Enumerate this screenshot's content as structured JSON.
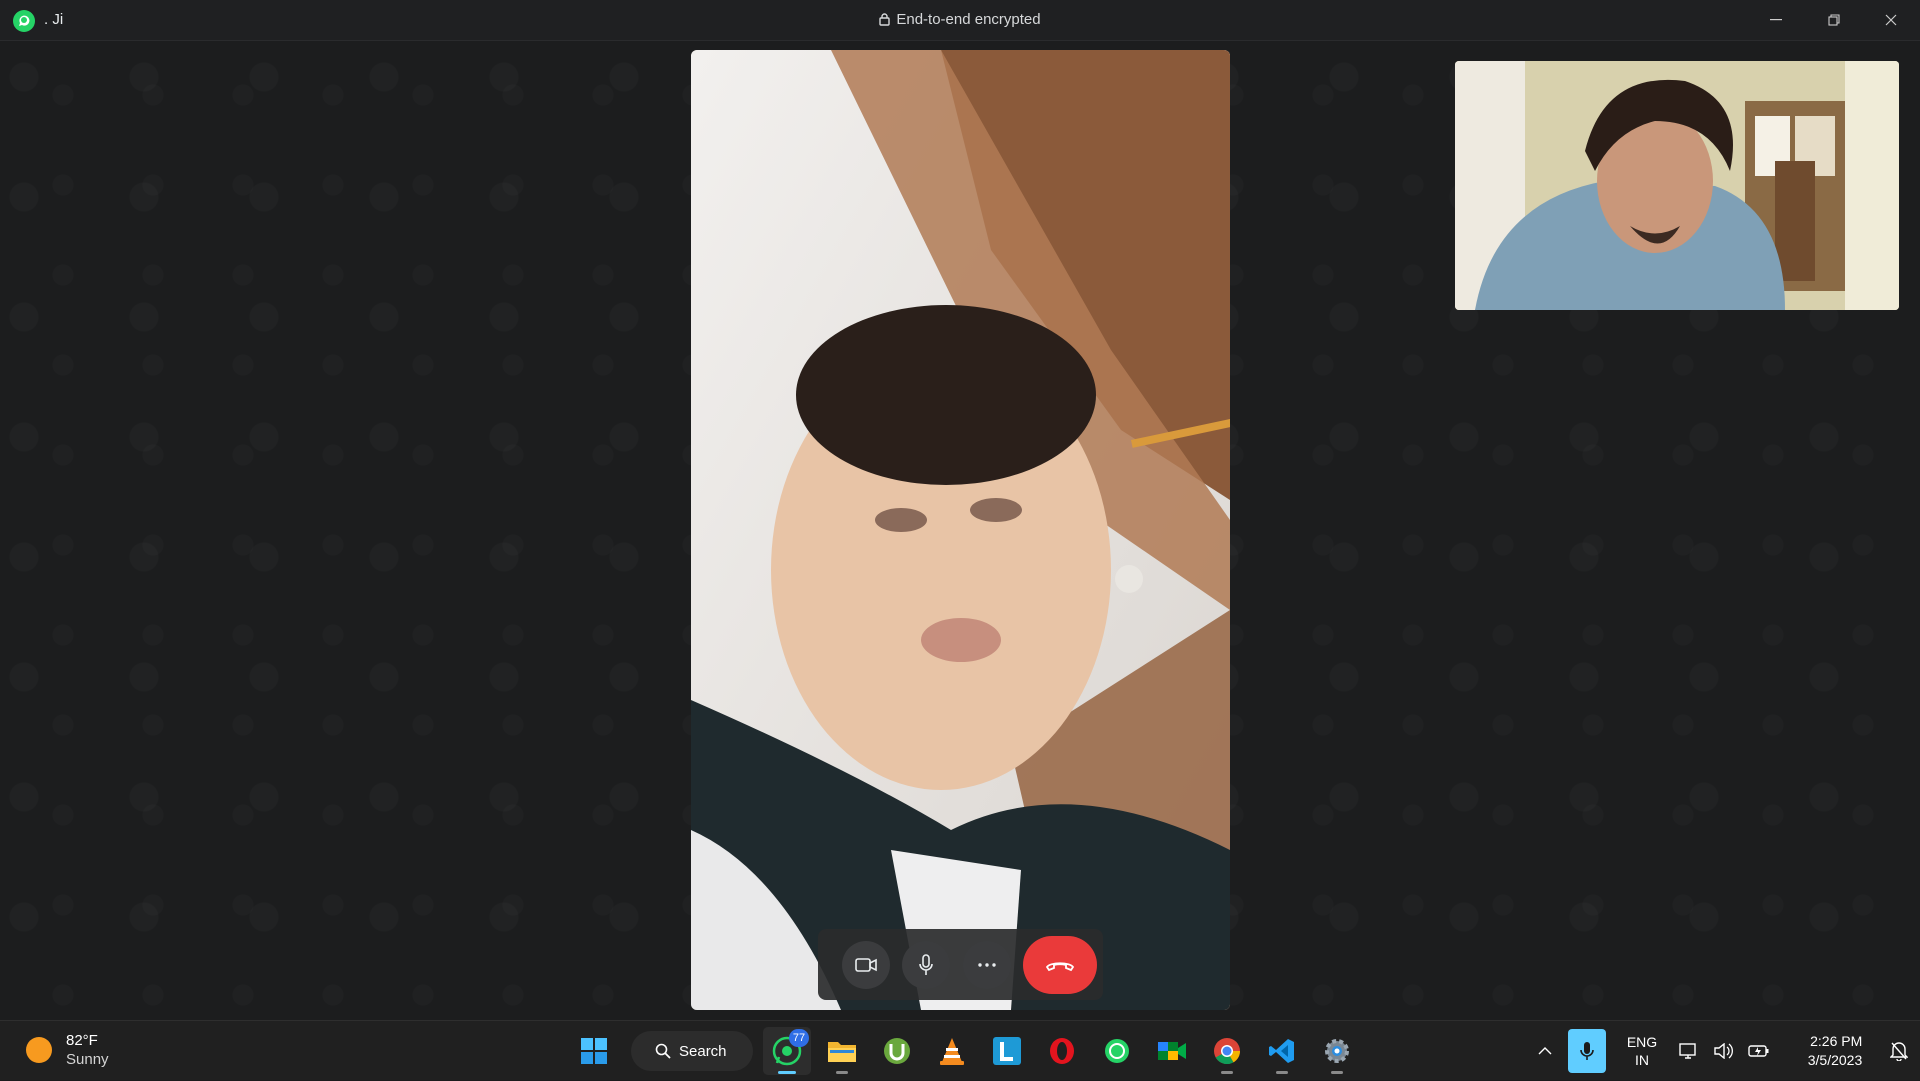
{
  "window": {
    "contact_name": ". Ji",
    "encryption_notice": "End-to-end encrypted"
  },
  "call": {
    "remote_video": "remote participant camera feed",
    "self_video": "self camera preview",
    "controls": {
      "video": "video-camera-icon",
      "mic": "microphone-icon",
      "more": "more-options-icon",
      "end": "end-call-icon"
    },
    "end_color": "#ea3a3a"
  },
  "taskbar": {
    "weather": {
      "temp": "82°F",
      "condition": "Sunny"
    },
    "search_label": "Search",
    "whatsapp_badge": "77",
    "apps": [
      "start",
      "search",
      "whatsapp",
      "file-explorer",
      "utorrent",
      "vlc",
      "l-app",
      "opera",
      "whatsapp-2",
      "meet",
      "chrome",
      "vscode",
      "settings"
    ],
    "language": {
      "lang": "ENG",
      "region": "IN"
    },
    "clock": {
      "time": "2:26 PM",
      "date": "3/5/2023"
    }
  }
}
